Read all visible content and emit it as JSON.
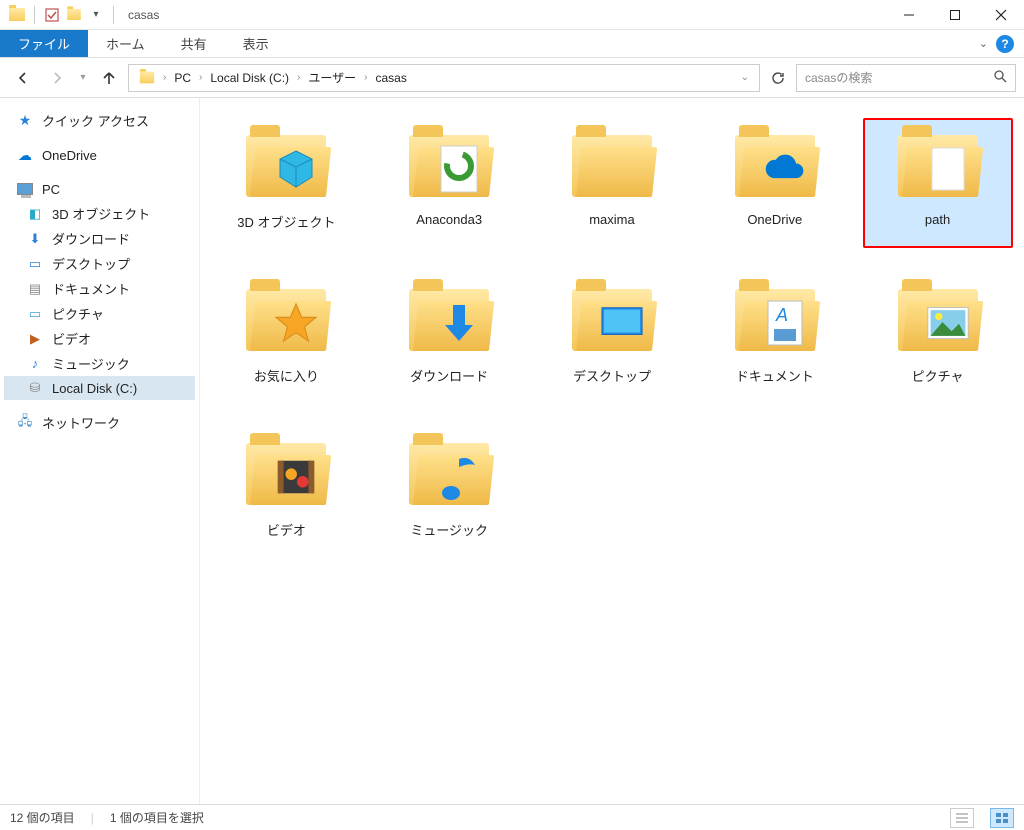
{
  "window": {
    "title": "casas"
  },
  "ribbon": {
    "file": "ファイル",
    "tabs": [
      "ホーム",
      "共有",
      "表示"
    ]
  },
  "breadcrumb": {
    "items": [
      "PC",
      "Local Disk (C:)",
      "ユーザー",
      "casas"
    ]
  },
  "search": {
    "placeholder": "casasの検索"
  },
  "sidebar": {
    "quick_access": "クイック アクセス",
    "onedrive": "OneDrive",
    "pc": "PC",
    "pc_children": [
      "3D オブジェクト",
      "ダウンロード",
      "デスクトップ",
      "ドキュメント",
      "ピクチャ",
      "ビデオ",
      "ミュージック",
      "Local Disk (C:)"
    ],
    "network": "ネットワーク"
  },
  "items": [
    {
      "label": "3D オブジェクト",
      "overlay": "cube",
      "selected": false
    },
    {
      "label": "Anaconda3",
      "overlay": "anaconda",
      "selected": false
    },
    {
      "label": "maxima",
      "overlay": "",
      "selected": false
    },
    {
      "label": "OneDrive",
      "overlay": "cloud",
      "selected": false
    },
    {
      "label": "path",
      "overlay": "doc",
      "selected": true
    },
    {
      "label": "お気に入り",
      "overlay": "star",
      "selected": false
    },
    {
      "label": "ダウンロード",
      "overlay": "download",
      "selected": false
    },
    {
      "label": "デスクトップ",
      "overlay": "desktop",
      "selected": false
    },
    {
      "label": "ドキュメント",
      "overlay": "document",
      "selected": false
    },
    {
      "label": "ピクチャ",
      "overlay": "picture",
      "selected": false
    },
    {
      "label": "ビデオ",
      "overlay": "video",
      "selected": false
    },
    {
      "label": "ミュージック",
      "overlay": "music",
      "selected": false
    }
  ],
  "status": {
    "count": "12 個の項目",
    "selection": "1 個の項目を選択"
  }
}
